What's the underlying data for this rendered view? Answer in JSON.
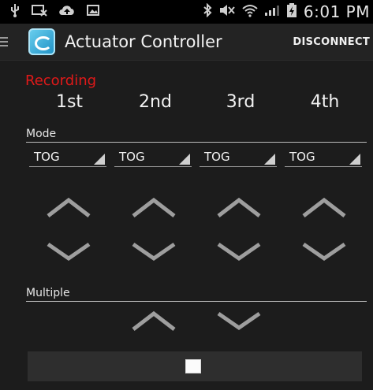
{
  "status_bar": {
    "icons": [
      "usb-icon",
      "keyboard-icon",
      "cloud-upload-icon",
      "image-icon",
      "bluetooth-icon",
      "mute-icon",
      "wifi-icon",
      "signal-icon",
      "battery-charging-icon"
    ],
    "time": "6:01 PM"
  },
  "action_bar": {
    "title": "Actuator Controller",
    "disconnect_label": "DISCONNECT"
  },
  "recording_label": "Recording",
  "columns": [
    "1st",
    "2nd",
    "3rd",
    "4th"
  ],
  "mode": {
    "label": "Mode",
    "values": [
      "TOG",
      "TOG",
      "TOG",
      "TOG"
    ]
  },
  "multiple": {
    "label": "Multiple"
  },
  "colors": {
    "background": "#1c1c1c",
    "recording": "#e01919",
    "chevron": "#9e9e9e"
  }
}
